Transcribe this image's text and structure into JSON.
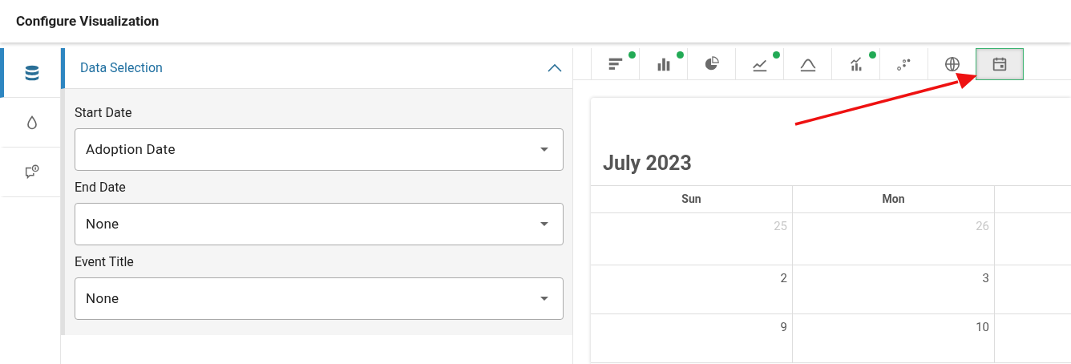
{
  "header": {
    "title": "Configure Visualization"
  },
  "rail": [
    {
      "kind": "database",
      "selected": true
    },
    {
      "kind": "droplet",
      "selected": false
    },
    {
      "kind": "comment",
      "selected": false
    }
  ],
  "panel": {
    "title": "Data Selection",
    "expanded": true,
    "fields": [
      {
        "label": "Start Date",
        "value": "Adoption Date"
      },
      {
        "label": "End Date",
        "value": "None"
      },
      {
        "label": "Event Title",
        "value": "None"
      }
    ]
  },
  "chart_types": [
    {
      "kind": "hbar",
      "flagged": true,
      "selected": false
    },
    {
      "kind": "vbar",
      "flagged": true,
      "selected": false
    },
    {
      "kind": "pie",
      "flagged": false,
      "selected": false
    },
    {
      "kind": "line",
      "flagged": true,
      "selected": false
    },
    {
      "kind": "bell",
      "flagged": false,
      "selected": false
    },
    {
      "kind": "combo",
      "flagged": true,
      "selected": false
    },
    {
      "kind": "scatter",
      "flagged": false,
      "selected": false
    },
    {
      "kind": "globe",
      "flagged": false,
      "selected": false
    },
    {
      "kind": "calendar",
      "flagged": false,
      "selected": true
    }
  ],
  "calendar": {
    "title": "July 2023",
    "columns": [
      "Sun",
      "Mon"
    ],
    "weeks": [
      [
        {
          "day": "25",
          "outside": true
        },
        {
          "day": "26",
          "outside": true
        }
      ],
      [
        {
          "day": "2",
          "outside": false
        },
        {
          "day": "3",
          "outside": false
        }
      ],
      [
        {
          "day": "9",
          "outside": false
        },
        {
          "day": "10",
          "outside": false
        }
      ]
    ]
  }
}
